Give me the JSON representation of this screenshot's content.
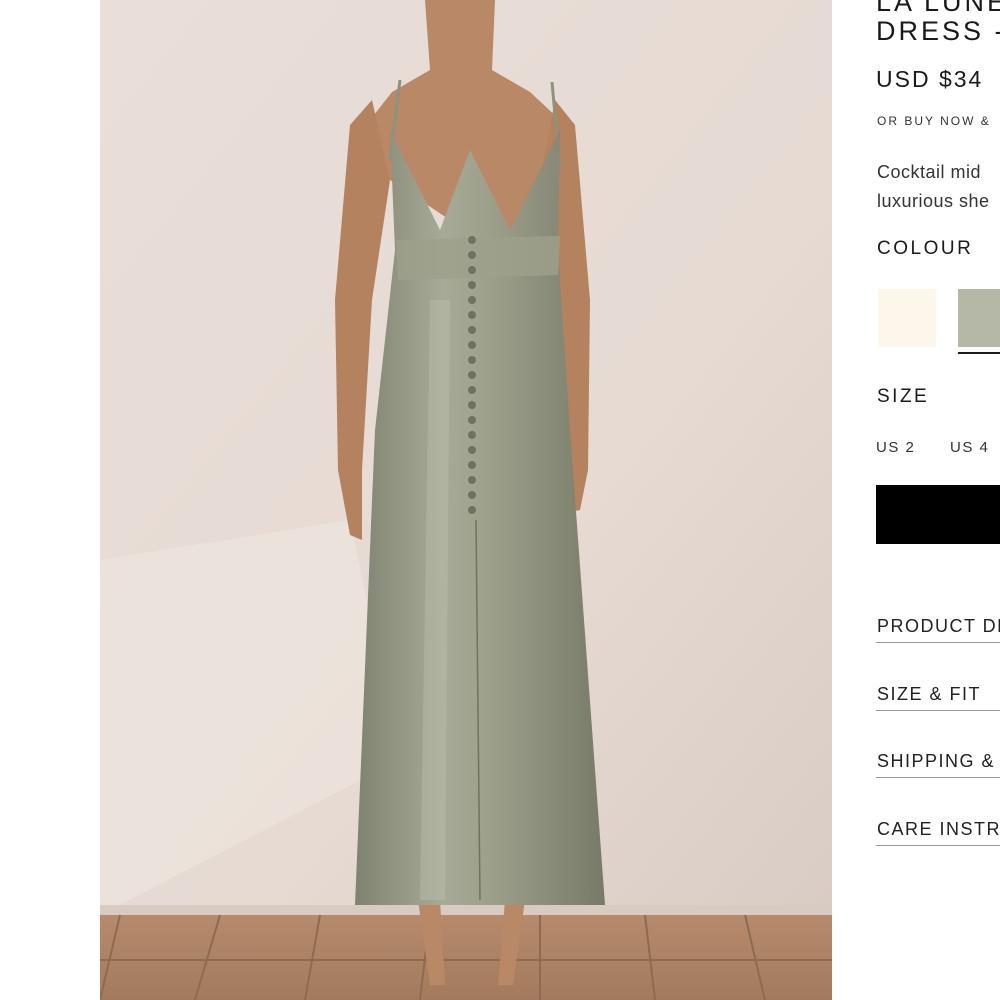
{
  "product": {
    "title_line1": "LA LUNE",
    "title_line2": "DRESS -",
    "price": "USD $34",
    "afterpay": "OR BUY NOW &",
    "description_line1": "Cocktail mid",
    "description_line2": "luxurious she"
  },
  "colour": {
    "label": "COLOUR",
    "swatches": [
      {
        "name": "ivory",
        "color": "#fdf6ea"
      },
      {
        "name": "sage",
        "color": "#b6b8a7",
        "selected": true
      }
    ]
  },
  "size": {
    "label": "SIZE",
    "options": [
      "US 2",
      "US 4"
    ]
  },
  "add_button": {
    "color": "#000000"
  },
  "accordion": [
    {
      "label": "PRODUCT DE"
    },
    {
      "label": "SIZE & FIT"
    },
    {
      "label": "SHIPPING & R"
    },
    {
      "label": "CARE INSTR"
    }
  ],
  "gallery": {
    "next_icon": "chevron-right-icon"
  }
}
